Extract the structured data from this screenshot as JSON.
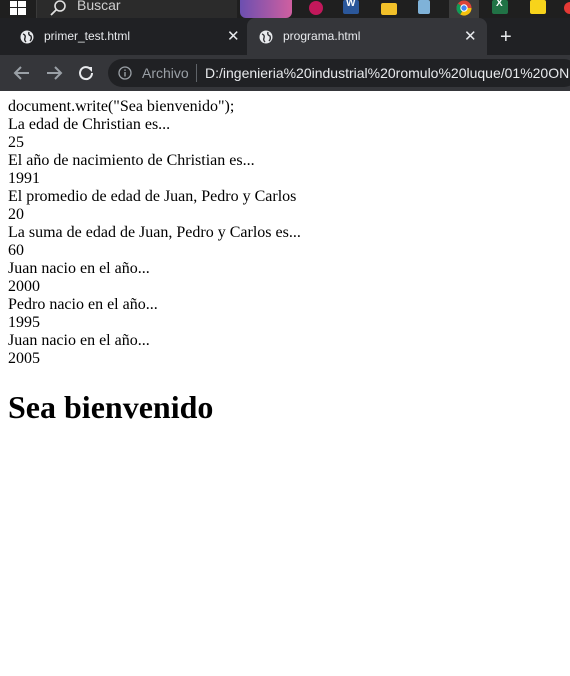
{
  "taskbar": {
    "search_placeholder": "Buscar",
    "apps": [
      "word-app",
      "explorer-app",
      "notes-app",
      "chrome-app",
      "excel-app",
      "sticky-app"
    ]
  },
  "tabs": [
    {
      "title": "primer_test.html",
      "active": false
    },
    {
      "title": "programa.html",
      "active": true
    }
  ],
  "toolbar": {
    "scheme_label": "Archivo",
    "url": "D:/ingenieria%20industrial%20romulo%20luque/01%20ON"
  },
  "page": {
    "lines": [
      "document.write(\"Sea bienvenido\");",
      "La edad de Christian es...",
      "25",
      "El año de nacimiento de Christian es...",
      "1991",
      "El promedio de edad de Juan, Pedro y Carlos",
      "20",
      "La suma de edad de Juan, Pedro y Carlos es...",
      "60",
      "Juan nacio en el año...",
      "2000",
      "Pedro nacio en el año...",
      "1995",
      "Juan nacio en el año...",
      "2005"
    ],
    "heading": "Sea bienvenido"
  },
  "colors": {
    "tabstrip_bg": "#202124",
    "toolbar_bg": "#35363a",
    "text_light": "#e8eaed"
  }
}
